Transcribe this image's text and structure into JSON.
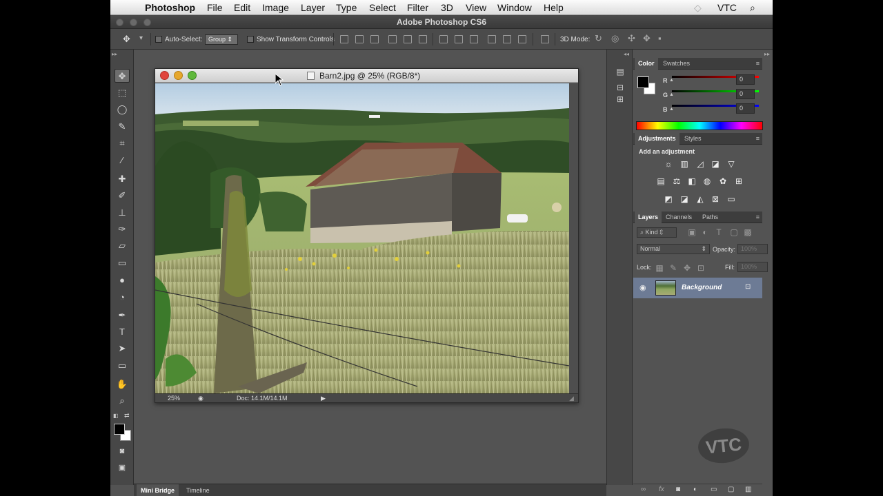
{
  "menubar": {
    "app": "Photoshop",
    "items": [
      "File",
      "Edit",
      "Image",
      "Layer",
      "Type",
      "Select",
      "Filter",
      "3D",
      "View",
      "Window",
      "Help"
    ],
    "right_label": "VTC"
  },
  "window": {
    "title": "Adobe Photoshop CS6"
  },
  "options_bar": {
    "auto_select_label": "Auto-Select:",
    "auto_select_value": "Group",
    "show_transform_label": "Show Transform Controls",
    "mode_3d_label": "3D Mode:"
  },
  "tools": [
    "move-tool",
    "marquee-tool",
    "lasso-tool",
    "quick-selection-tool",
    "crop-tool",
    "eyedropper-tool",
    "healing-brush-tool",
    "brush-tool",
    "clone-stamp-tool",
    "history-brush-tool",
    "eraser-tool",
    "gradient-tool",
    "blur-tool",
    "dodge-tool",
    "pen-tool",
    "type-tool",
    "path-selection-tool",
    "rectangle-tool",
    "hand-tool",
    "zoom-tool"
  ],
  "document": {
    "title": "Barn2.jpg @ 25% (RGB/8*)",
    "zoom": "25%",
    "doc_size": "Doc: 14.1M/14.1M"
  },
  "color_panel": {
    "tabs": [
      "Color",
      "Swatches"
    ],
    "active_tab": "Color",
    "channels": [
      {
        "label": "R",
        "value": "0",
        "color": "#ff0000"
      },
      {
        "label": "G",
        "value": "0",
        "color": "#00ff00"
      },
      {
        "label": "B",
        "value": "0",
        "color": "#0000ff"
      }
    ]
  },
  "adjustments_panel": {
    "tabs": [
      "Adjustments",
      "Styles"
    ],
    "active_tab": "Adjustments",
    "heading": "Add an adjustment"
  },
  "layers_panel": {
    "tabs": [
      "Layers",
      "Channels",
      "Paths"
    ],
    "active_tab": "Layers",
    "filter_kind": "Kind",
    "blend_mode": "Normal",
    "opacity_label": "Opacity:",
    "opacity_value": "100%",
    "lock_label": "Lock:",
    "fill_label": "Fill:",
    "fill_value": "100%",
    "layers": [
      {
        "name": "Background",
        "locked": true,
        "visible": true
      }
    ]
  },
  "bottom_tabs": [
    "Mini Bridge",
    "Timeline"
  ],
  "watermark": "VTC"
}
